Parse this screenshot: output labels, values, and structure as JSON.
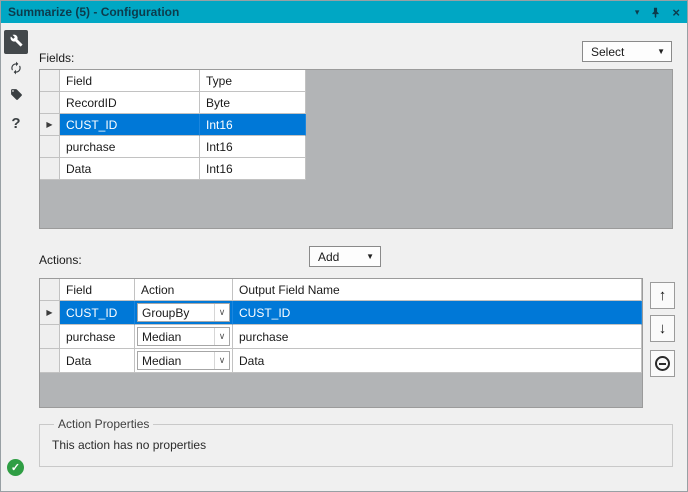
{
  "title_bar": {
    "title": "Summarize (5) - Configuration",
    "dropdown_icon": "▾",
    "close_icon": "×"
  },
  "sidebar": {
    "items": [
      {
        "id": "configuration",
        "icon": "wrench-icon",
        "selected": true
      },
      {
        "id": "refresh",
        "icon": "circular-arrows-icon",
        "selected": false
      },
      {
        "id": "annotation",
        "icon": "tag-icon",
        "selected": false
      },
      {
        "id": "help",
        "icon": "question-icon",
        "glyph": "?",
        "selected": false
      }
    ],
    "status": {
      "icon": "check-circle",
      "glyph": "✓",
      "color": "#2f9e44"
    }
  },
  "fields_section": {
    "label": "Fields:",
    "select_button": {
      "label": "Select",
      "caret": "▼"
    },
    "grid": {
      "columns": [
        "Field",
        "Type"
      ],
      "selected_row_marker": "▶",
      "selected_index": 1,
      "rows": [
        {
          "field": "RecordID",
          "type": "Byte"
        },
        {
          "field": "CUST_ID",
          "type": "Int16"
        },
        {
          "field": "purchase",
          "type": "Int16"
        },
        {
          "field": "Data",
          "type": "Int16"
        }
      ]
    }
  },
  "actions_section": {
    "label": "Actions:",
    "add_button": {
      "label": "Add",
      "caret": "▼"
    },
    "grid": {
      "columns": [
        "Field",
        "Action",
        "Output Field Name"
      ],
      "selected_row_marker": "▶",
      "selected_index": 0,
      "dropdown_caret": "∨",
      "rows": [
        {
          "field": "CUST_ID",
          "action": "GroupBy",
          "output": "CUST_ID"
        },
        {
          "field": "purchase",
          "action": "Median",
          "output": "purchase"
        },
        {
          "field": "Data",
          "action": "Median",
          "output": "Data"
        }
      ]
    },
    "row_buttons": {
      "up": "↑",
      "down": "↓",
      "remove": "minus-circle"
    }
  },
  "action_properties": {
    "label": "Action Properties",
    "message": "This action has no properties"
  },
  "colors": {
    "titlebar_bg": "#00a7c4",
    "titlebar_text": "#0c3b4c",
    "selection_bg": "#0078d7",
    "selection_text": "#ffffff",
    "panel_fill": "#b2b4b6",
    "check_green": "#2f9e44"
  }
}
